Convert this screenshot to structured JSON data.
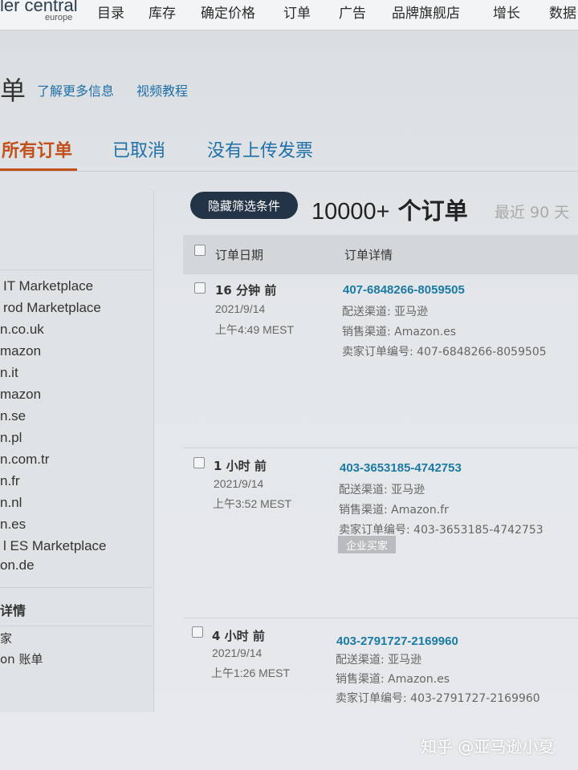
{
  "topnav": {
    "logo": "ler central",
    "logo_sub": "europe",
    "items": [
      "目录",
      "库存",
      "确定价格",
      "订单",
      "广告",
      "品牌旗舰店",
      "增长",
      "数据"
    ]
  },
  "header": {
    "title": "单",
    "learn_more": "了解更多信息",
    "video_tutorial": "视频教程"
  },
  "tabs": [
    "所有订单",
    "已取消",
    "没有上传发票"
  ],
  "sidebar": {
    "marketplaces": [
      "IT Marketplace",
      "rod Marketplace",
      "n.co.uk",
      "mazon",
      "n.it",
      "mazon",
      "n.se",
      "n.pl",
      "n.com.tr",
      "n.fr",
      "n.nl",
      "n.es",
      "l ES Marketplace",
      "on.de"
    ],
    "section_title": "详情",
    "sub_items": [
      "家",
      "on 账单"
    ]
  },
  "filter": {
    "hide_label": "隐藏筛选条件"
  },
  "summary": {
    "count": "10000+",
    "unit": "个订单",
    "recent": "最近 90 天"
  },
  "table": {
    "headers": {
      "date": "订单日期",
      "details": "订单详情"
    },
    "rows": [
      {
        "age": "16 分钟 前",
        "date": "2021/9/14",
        "time": "上午4:49 MEST",
        "order_id": "407-6848266-8059505",
        "channel": "配送渠道: 亚马逊",
        "sales": "销售渠道: Amazon.es",
        "seller_order": "卖家订单编号: 407-6848266-8059505"
      },
      {
        "age": "1 小时 前",
        "date": "2021/9/14",
        "time": "上午3:52 MEST",
        "order_id": "403-3653185-4742753",
        "channel": "配送渠道: 亚马逊",
        "sales": "销售渠道: Amazon.fr",
        "seller_order": "卖家订单编号: 403-3653185-4742753",
        "badge": "企业买家"
      },
      {
        "age": "4 小时 前",
        "date": "2021/9/14",
        "time": "上午1:26 MEST",
        "order_id": "403-2791727-2169960",
        "channel": "配送渠道: 亚马逊",
        "sales": "销售渠道: Amazon.es",
        "seller_order": "卖家订单编号: 403-2791727-2169960"
      }
    ]
  },
  "watermark": "知乎 @亚马逊小夏"
}
